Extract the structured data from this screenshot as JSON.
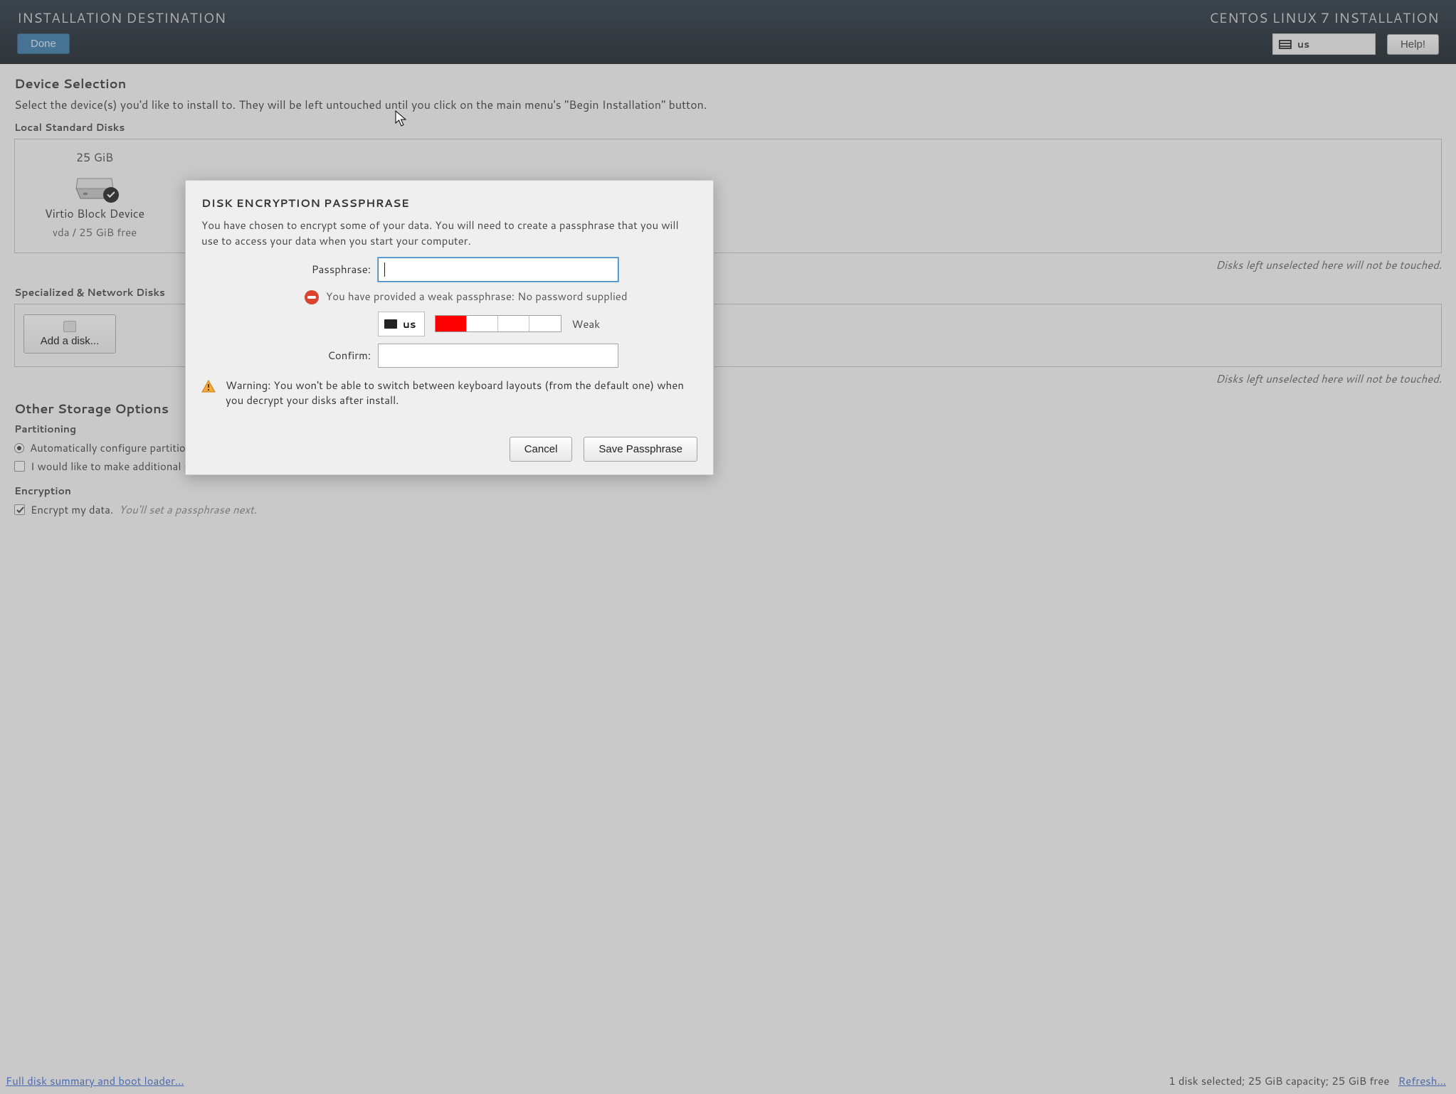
{
  "header": {
    "page_title": "INSTALLATION DESTINATION",
    "product_title": "CENTOS LINUX 7 INSTALLATION",
    "done_label": "Done",
    "help_label": "Help!",
    "keyboard_layout": "us"
  },
  "device_selection": {
    "title": "Device Selection",
    "description": "Select the device(s) you'd like to install to.  They will be left untouched until you click on the main menu's \"Begin Installation\" button.",
    "local_heading": "Local Standard Disks",
    "not_touched_hint": "Disks left unselected here will not be touched.",
    "disk": {
      "size": "25 GiB",
      "name": "Virtio Block Device",
      "subtext": "vda  /  25 GiB free",
      "selected": true
    },
    "network_heading": "Specialized & Network Disks",
    "add_disk_label": "Add a disk..."
  },
  "storage_options": {
    "title": "Other Storage Options",
    "partitioning_heading": "Partitioning",
    "auto_label": "Automatically configure partitioning.",
    "auto_selected": true,
    "extra_space_label": "I would like to make additional space available.",
    "extra_space_checked": false,
    "encryption_heading": "Encryption",
    "encrypt_label": "Encrypt my data.",
    "encrypt_hint": "You'll set a passphrase next.",
    "encrypt_checked": true
  },
  "footer": {
    "summary_link": "Full disk summary and boot loader...",
    "status": "1 disk selected; 25 GiB capacity; 25 GiB free",
    "refresh_link": "Refresh..."
  },
  "modal": {
    "title": "DISK ENCRYPTION PASSPHRASE",
    "intro": "You have chosen to encrypt some of your data. You will need to create a passphrase that you will use to access your data when you start your computer.",
    "passphrase_label": "Passphrase:",
    "confirm_label": "Confirm:",
    "passphrase_value": "",
    "confirm_value": "",
    "error_text": "You have provided a weak passphrase: No password supplied",
    "keyboard_layout": "us",
    "strength_label": "Weak",
    "strength_filled_segments": 1,
    "strength_total_segments": 4,
    "warning_text": "Warning: You won't be able to switch between keyboard layouts (from the default one) when you decrypt your disks after install.",
    "cancel_label": "Cancel",
    "save_label": "Save Passphrase"
  }
}
